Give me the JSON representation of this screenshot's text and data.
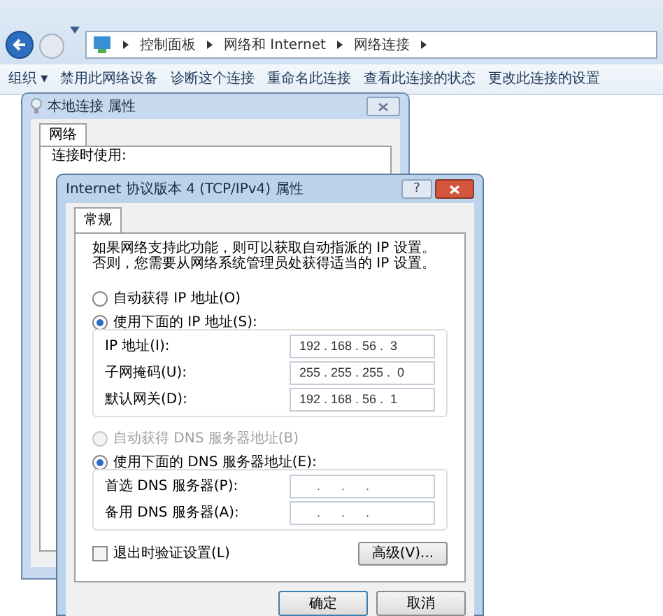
{
  "address_bar": {
    "breadcrumbs": [
      "控制面板",
      "网络和 Internet",
      "网络连接"
    ]
  },
  "toolbar": {
    "items": [
      "组织 ▾",
      "禁用此网络设备",
      "诊断这个连接",
      "重命名此连接",
      "查看此连接的状态",
      "更改此连接的设置"
    ]
  },
  "back_dialog": {
    "title": "本地连接 属性",
    "tabs": [
      {
        "label": "网络",
        "selected": true
      }
    ],
    "label": "连接时使用:"
  },
  "dialog": {
    "title": "Internet 协议版本 4 (TCP/IPv4) 属性",
    "help_button": "?",
    "tabs": [
      {
        "label": "常规",
        "selected": true
      }
    ],
    "description": "如果网络支持此功能，则可以获取自动指派的 IP 设置。否则，您需要从网络系统管理员处获得适当的 IP 设置。",
    "ip_mode": [
      {
        "label": "自动获得 IP 地址(O)",
        "selected": false,
        "disabled": false
      },
      {
        "label": "使用下面的 IP 地址(S):",
        "selected": true,
        "disabled": false
      }
    ],
    "ip_fields": [
      {
        "label": "IP 地址(I):",
        "value": "192 . 168 . 56 .  3"
      },
      {
        "label": "子网掩码(U):",
        "value": "255 . 255 . 255 .  0"
      },
      {
        "label": "默认网关(D):",
        "value": "192 . 168 . 56 .  1"
      }
    ],
    "dns_mode": [
      {
        "label": "自动获得 DNS 服务器地址(B)",
        "selected": false,
        "disabled": true
      },
      {
        "label": "使用下面的 DNS 服务器地址(E):",
        "selected": true,
        "disabled": false
      }
    ],
    "dns_fields": [
      {
        "label": "首选 DNS 服务器(P):",
        "value": "     .      .      ."
      },
      {
        "label": "备用 DNS 服务器(A):",
        "value": "     .      .      ."
      }
    ],
    "validate_checkbox": {
      "label": "退出时验证设置(L)",
      "checked": false
    },
    "advanced_button": "高级(V)...",
    "buttons": [
      {
        "label": "确定",
        "default": true
      },
      {
        "label": "取消",
        "default": false
      }
    ]
  }
}
